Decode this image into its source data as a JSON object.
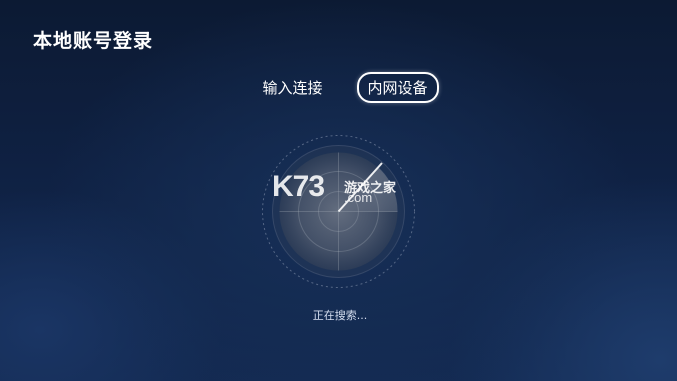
{
  "header": {
    "title": "本地账号登录"
  },
  "mode_switch": {
    "tabs": [
      {
        "label": "输入连接",
        "active": false
      },
      {
        "label": "内网设备",
        "active": true
      }
    ]
  },
  "scanner": {
    "status": "正在搜索..."
  },
  "watermark": {
    "brand": "K73",
    "name": "游戏之家",
    "domain": ".com"
  },
  "colors": {
    "background_top": "#0c1a33",
    "background_bottom": "#132a52",
    "text": "#ffffff",
    "radar_disc": "#5a6272"
  },
  "icons": {
    "radar": "radar-scan-icon"
  }
}
